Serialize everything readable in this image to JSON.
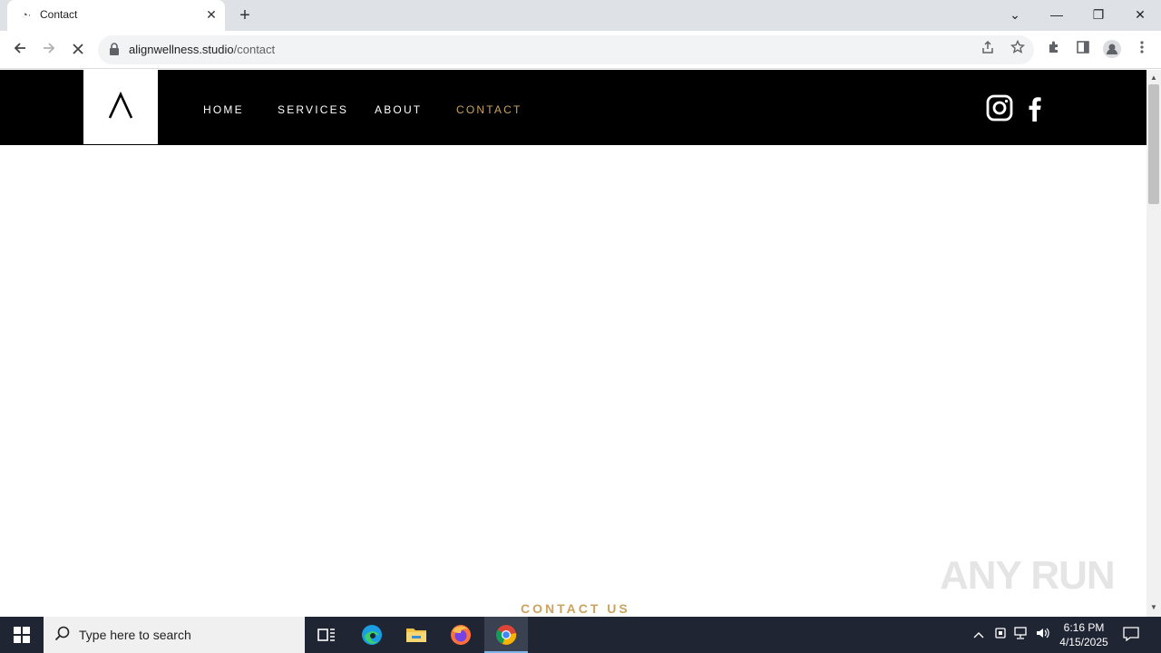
{
  "browser": {
    "tab": {
      "title": "Contact",
      "close": "✕"
    },
    "new_tab": "+",
    "window_controls": {
      "dropdown": "⌄",
      "minimize": "—",
      "restore": "❐",
      "close": "✕"
    },
    "url": {
      "host": "alignwellness.studio",
      "path": "/contact"
    }
  },
  "site": {
    "nav": [
      {
        "label": "HOME"
      },
      {
        "label": "SERVICES"
      },
      {
        "label": "ABOUT"
      },
      {
        "label": "CONTACT",
        "active": true
      }
    ],
    "accent_color": "#c9a35f",
    "section_heading": "CONTACT US"
  },
  "watermark": "ANY RUN",
  "taskbar": {
    "search_placeholder": "Type here to search",
    "time": "6:16 PM",
    "date": "4/15/2025"
  }
}
